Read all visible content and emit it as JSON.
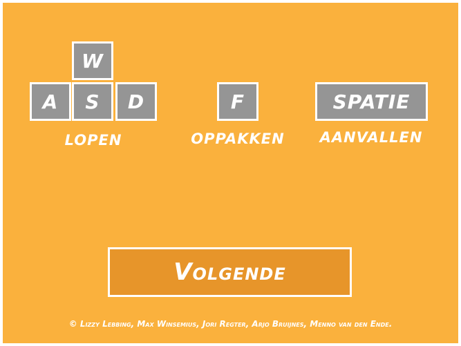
{
  "controls": {
    "move": {
      "keys": {
        "up": "W",
        "left": "A",
        "down": "S",
        "right": "D"
      },
      "label": "LOPEN"
    },
    "pickup": {
      "key": "F",
      "label": "OPPAKKEN"
    },
    "attack": {
      "key": "SPATIE",
      "label": "AANVALLEN"
    }
  },
  "next_button": {
    "label": "Volgende"
  },
  "credits": "© Lizzy Lebbing, Max Winsemius, Jori Regter, Arjo Bruijnes, Menno van den Ende.",
  "colors": {
    "background": "#fab13d",
    "key": "#959595",
    "button": "#e7952a",
    "text": "#ffffff"
  }
}
